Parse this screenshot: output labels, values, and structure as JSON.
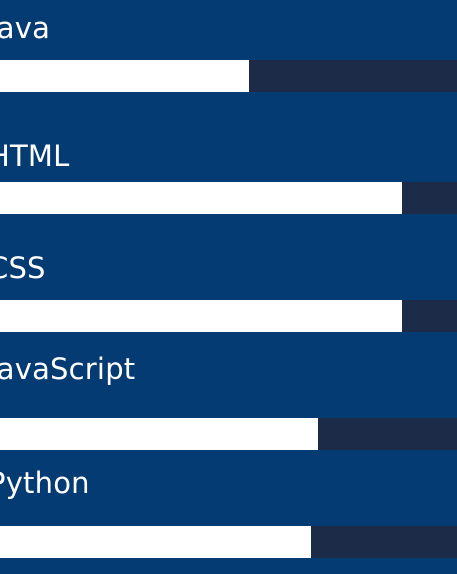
{
  "skills": [
    {
      "label": "Java",
      "level_fraction": 0.545
    },
    {
      "label": "HTML",
      "level_fraction": 0.88
    },
    {
      "label": "CSS",
      "level_fraction": 0.88
    },
    {
      "label": "JavaScript",
      "level_fraction": 0.695
    },
    {
      "label": "Python",
      "level_fraction": 0.68
    }
  ]
}
